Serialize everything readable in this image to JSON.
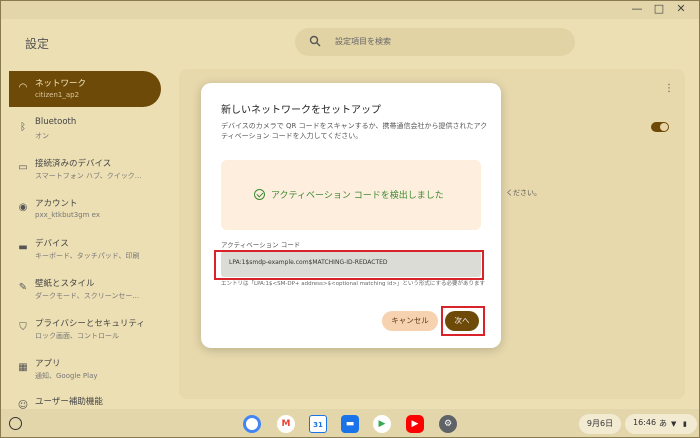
{
  "window": {
    "minimize": "—",
    "maximize": "□",
    "close": "✕"
  },
  "app": {
    "title": "設定",
    "search_placeholder": "設定項目を検索"
  },
  "sidebar": {
    "items": [
      {
        "label": "ネットワーク",
        "sub": "citizen1_ap2",
        "icon": "wifi-icon",
        "active": true
      },
      {
        "label": "Bluetooth",
        "sub": "オン",
        "icon": "bluetooth-icon"
      },
      {
        "label": "接続済みのデバイス",
        "sub": "スマートフォン ハブ、クイック...",
        "icon": "devices-icon"
      },
      {
        "label": "アカウント",
        "sub": "pxx_ktkbut3gm ex",
        "icon": "account-icon"
      },
      {
        "label": "デバイス",
        "sub": "キーボード、タッチパッド、印刷",
        "icon": "laptop-icon"
      },
      {
        "label": "壁紙とスタイル",
        "sub": "ダークモード、スクリーンセー...",
        "icon": "palette-icon"
      },
      {
        "label": "プライバシーとセキュリティ",
        "sub": "ロック画面、コントロール",
        "icon": "shield-icon"
      },
      {
        "label": "アプリ",
        "sub": "通知、Google Play",
        "icon": "apps-icon"
      },
      {
        "label": "ユーザー補助機能",
        "sub": "",
        "icon": "accessibility-icon"
      }
    ]
  },
  "content": {
    "bg_text": "ください。"
  },
  "dialog": {
    "title": "新しいネットワークをセットアップ",
    "description": "デバイスのカメラで QR コードをスキャンするか、携帯通信会社から提供されたアクティベーション コードを入力してください。",
    "detected_text": "アクティベーション コードを検出しました",
    "field_label": "アクティベーション コード",
    "field_value": "LPA:1$smdp-example.com$MATCHING-ID-REDACTED",
    "hint": "エントリは「LPA:1$<SM-DP+ address>$<optional matching id>」という形式にする必要があります",
    "cancel_label": "キャンセル",
    "next_label": "次へ"
  },
  "shelf": {
    "date": "9月6日",
    "time": "16:46",
    "ime": "あ",
    "apps": [
      {
        "name": "chrome-icon",
        "glyph": "●",
        "color": "#db4437"
      },
      {
        "name": "gmail-icon",
        "glyph": "M",
        "color": "#ea4335"
      },
      {
        "name": "calendar-icon",
        "glyph": "31",
        "color": "#1a73e8"
      },
      {
        "name": "files-icon",
        "glyph": "▬",
        "color": "#1a73e8"
      },
      {
        "name": "play-store-icon",
        "glyph": "▶",
        "color": "#34a853"
      },
      {
        "name": "youtube-icon",
        "glyph": "▶",
        "color": "#ff0000"
      },
      {
        "name": "settings-app-icon",
        "glyph": "⚙",
        "color": "#5f6368"
      }
    ]
  }
}
